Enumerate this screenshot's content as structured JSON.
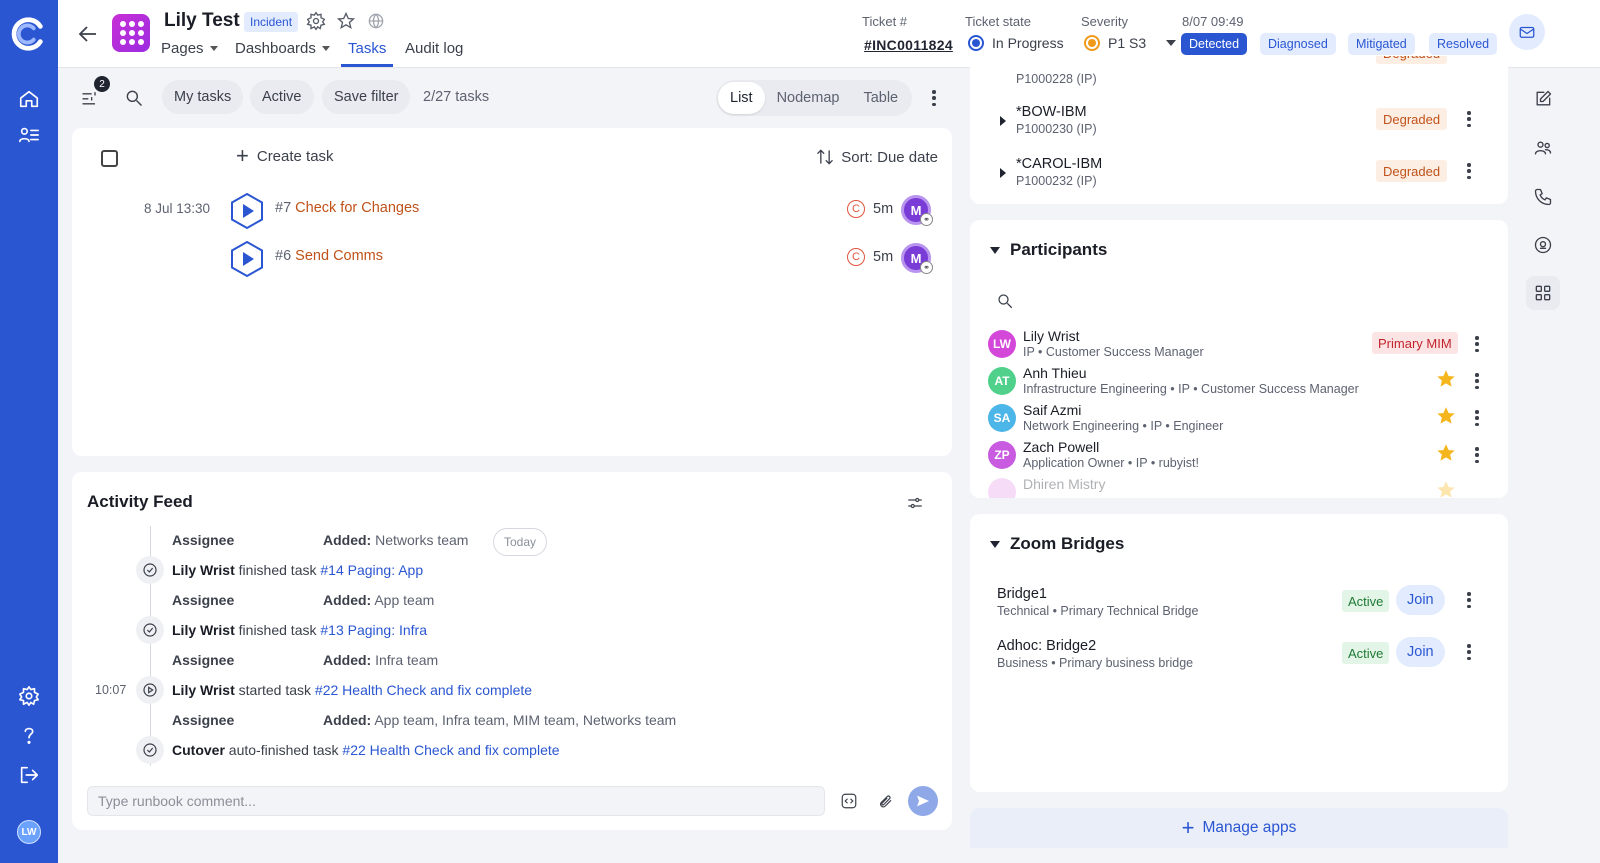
{
  "header": {
    "title": "Lily Test",
    "badge": "Incident",
    "tabs": [
      {
        "label": "Pages"
      },
      {
        "label": "Dashboards"
      },
      {
        "label": "Tasks"
      },
      {
        "label": "Audit log"
      }
    ],
    "ticket_label": "Ticket #",
    "ticket_value": "#INC0011824",
    "state_label": "Ticket state",
    "state_value": "In Progress",
    "severity_label": "Severity",
    "severity_value": "P1 S3",
    "timestamp": "8/07 09:49",
    "stages": [
      "Detected",
      "Diagnosed",
      "Mitigated",
      "Resolved"
    ],
    "active_stage": "Detected"
  },
  "toolbar": {
    "filter_count": "2",
    "chips": [
      "My tasks",
      "Active",
      "Save filter"
    ],
    "task_count": "2/27 tasks",
    "views": [
      "List",
      "Nodemap",
      "Table"
    ],
    "active_view": "List"
  },
  "tasks": {
    "create_label": "Create task",
    "sort_label": "Sort: Due date",
    "items": [
      {
        "time": "8 Jul 13:30",
        "num": "#7",
        "name": "Check for Changes",
        "duration": "5m",
        "avatar": "M"
      },
      {
        "time": "",
        "num": "#6",
        "name": "Send Comms",
        "duration": "5m",
        "avatar": "M"
      }
    ]
  },
  "activity": {
    "title": "Activity Feed",
    "today": "Today",
    "rows": [
      {
        "type": "assign",
        "label": "Assignee",
        "added_prefix": "Added:",
        "added": "Networks team"
      },
      {
        "type": "event",
        "time": "",
        "actor": "Lily Wrist",
        "verb": "finished task",
        "link": "#14 Paging: App"
      },
      {
        "type": "assign",
        "label": "Assignee",
        "added_prefix": "Added:",
        "added": "App team"
      },
      {
        "type": "event",
        "time": "",
        "actor": "Lily Wrist",
        "verb": "finished task",
        "link": "#13 Paging: Infra"
      },
      {
        "type": "assign",
        "label": "Assignee",
        "added_prefix": "Added:",
        "added": "Infra team"
      },
      {
        "type": "event",
        "time": "10:07",
        "actor": "Lily Wrist",
        "verb": "started task",
        "link": "#22 Health Check and fix complete"
      },
      {
        "type": "assign",
        "label": "Assignee",
        "added_prefix": "Added:",
        "added": "App team, Infra team, MIM team, Networks team"
      },
      {
        "type": "event",
        "time": "",
        "actor": "Cutover",
        "verb": "auto-finished task",
        "link": "#22 Health Check and fix complete"
      }
    ],
    "comment_placeholder": "Type runbook comment..."
  },
  "services": {
    "partial_top": {
      "id": "P1000228 (IP)",
      "status": "Degraded"
    },
    "items": [
      {
        "name": "*BOW-IBM",
        "id": "P1000230 (IP)",
        "status": "Degraded"
      },
      {
        "name": "*CAROL-IBM",
        "id": "P1000232 (IP)",
        "status": "Degraded"
      }
    ]
  },
  "participants": {
    "title": "Participants",
    "items": [
      {
        "initials": "LW",
        "name": "Lily Wrist",
        "sub": "IP • Customer Success Manager",
        "badge": "Primary MIM",
        "color": "#d448d9"
      },
      {
        "initials": "AT",
        "name": "Anh Thieu",
        "sub": "Infrastructure Engineering • IP • Customer Success Manager",
        "star": true,
        "color": "#4fd18b"
      },
      {
        "initials": "SA",
        "name": "Saif Azmi",
        "sub": "Network Engineering • IP • Engineer",
        "star": true,
        "color": "#4db6e8"
      },
      {
        "initials": "ZP",
        "name": "Zach Powell",
        "sub": "Application Owner • IP • rubyist!",
        "star": true,
        "color": "#c85be0"
      },
      {
        "initials": "",
        "name": "Dhiren Mistry",
        "sub": "",
        "star": true,
        "color": "#e89be8"
      }
    ]
  },
  "bridges": {
    "title": "Zoom Bridges",
    "items": [
      {
        "name": "Bridge1",
        "sub": "Technical • Primary Technical Bridge",
        "status": "Active",
        "action": "Join"
      },
      {
        "name": "Adhoc: Bridge2",
        "sub": "Business • Primary business bridge",
        "status": "Active",
        "action": "Join"
      }
    ]
  },
  "footer": {
    "manage_apps": "Manage apps"
  },
  "user": {
    "initials": "LW"
  },
  "colors": {
    "brand": "#2a56d2",
    "degraded": "#c0521a",
    "active": "#1f7a34",
    "task_link": "#c0521a"
  }
}
